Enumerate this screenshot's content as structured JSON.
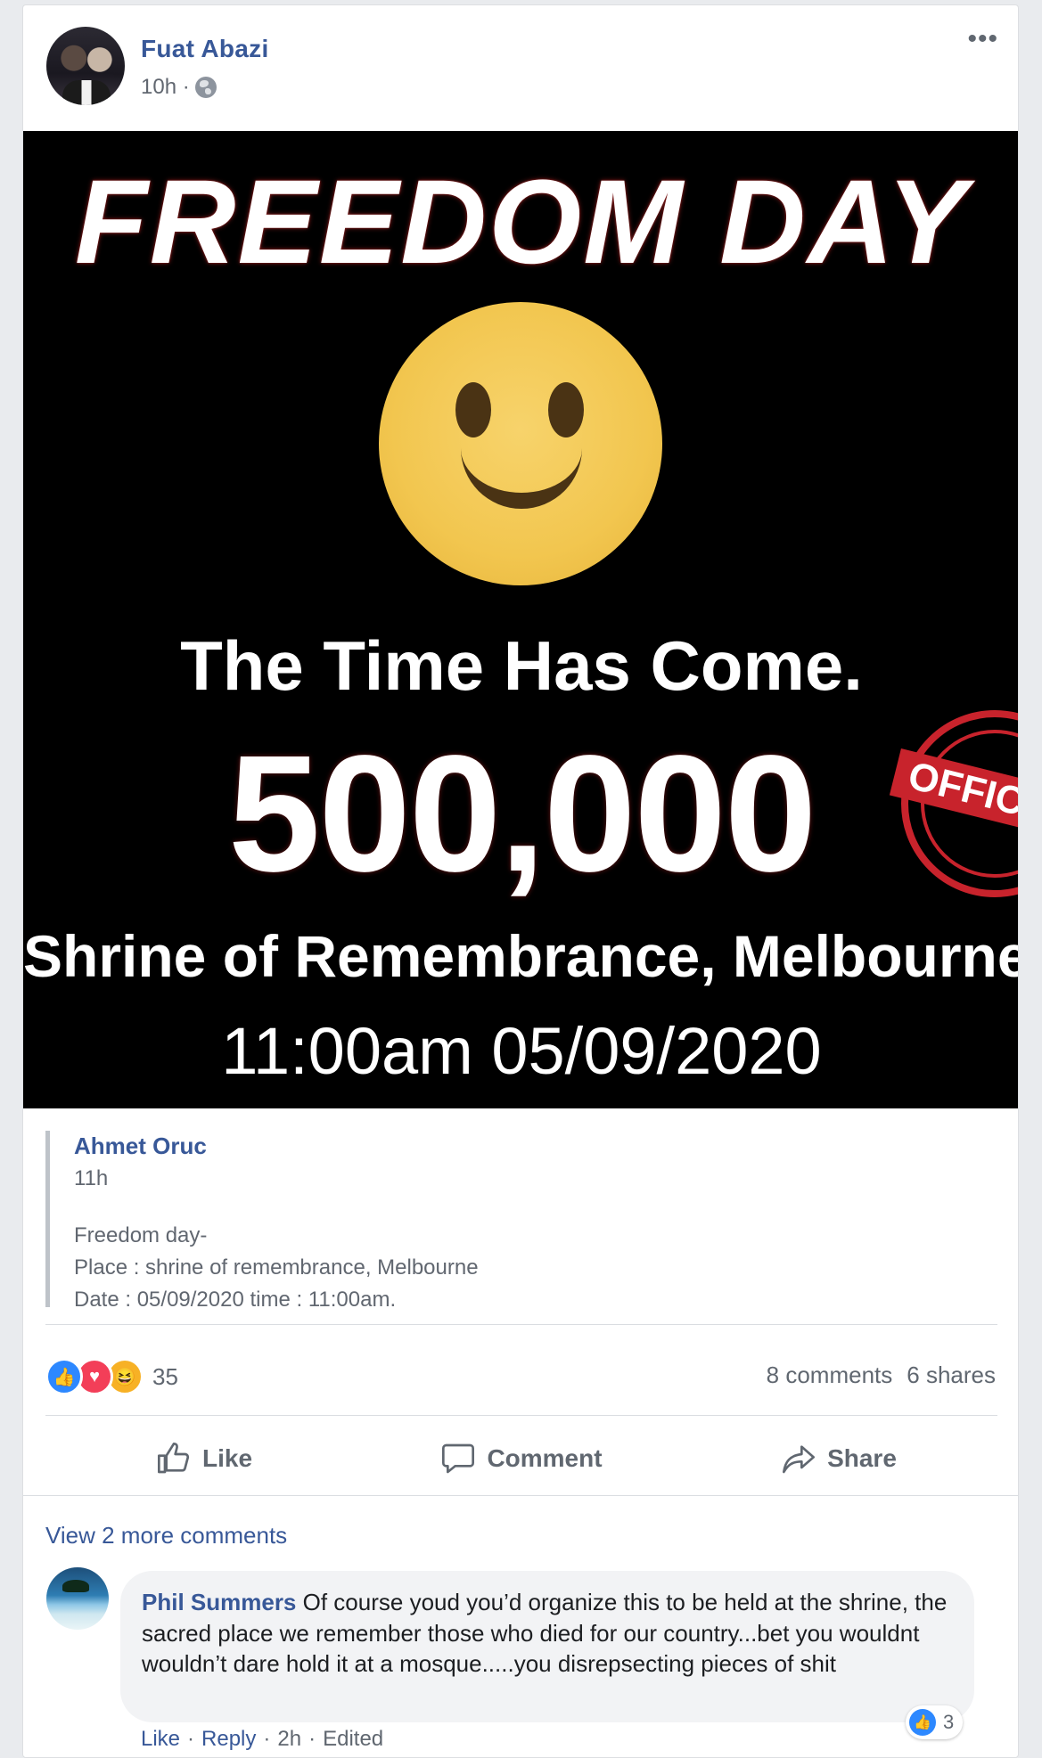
{
  "post": {
    "author": "Fuat Abazi",
    "time": "10h ·",
    "more_label": "•••"
  },
  "poster": {
    "title": "FREEDOM DAY",
    "line1": "The Time Has Come.",
    "number": "500,000",
    "stamp_text": "OFFICI",
    "place": "Shrine of Remembrance, Melbourne",
    "when": "11:00am 05/09/2020"
  },
  "shared": {
    "author": "Ahmet Oruc",
    "time": "11h",
    "lines": [
      "Freedom day-",
      "Place : shrine of remembrance, Melbourne",
      "Date : 05/09/2020 time : 11:00am."
    ]
  },
  "reactions": {
    "count": "35",
    "comments": "8 comments",
    "shares": "6 shares"
  },
  "actions": {
    "like": "Like",
    "comment": "Comment",
    "share": "Share"
  },
  "comments": {
    "view_more": "View 2 more comments",
    "items": [
      {
        "author": "Phil Summers",
        "text": "Of course youd you’d organize this to be held at the shrine, the sacred place we remember those who died for our country...bet you wouldnt wouldn’t dare hold it at a mosque.....you disrepsecting pieces of shit",
        "like": "Like",
        "reply": "Reply",
        "time": "2h",
        "edited": "Edited",
        "reaction_count": "3"
      }
    ]
  },
  "colors": {
    "link_blue": "#385898",
    "like_blue": "#2d88ff",
    "love_red": "#f33e58",
    "haha_yellow": "#f7b125",
    "stamp_red": "#c8232c"
  }
}
